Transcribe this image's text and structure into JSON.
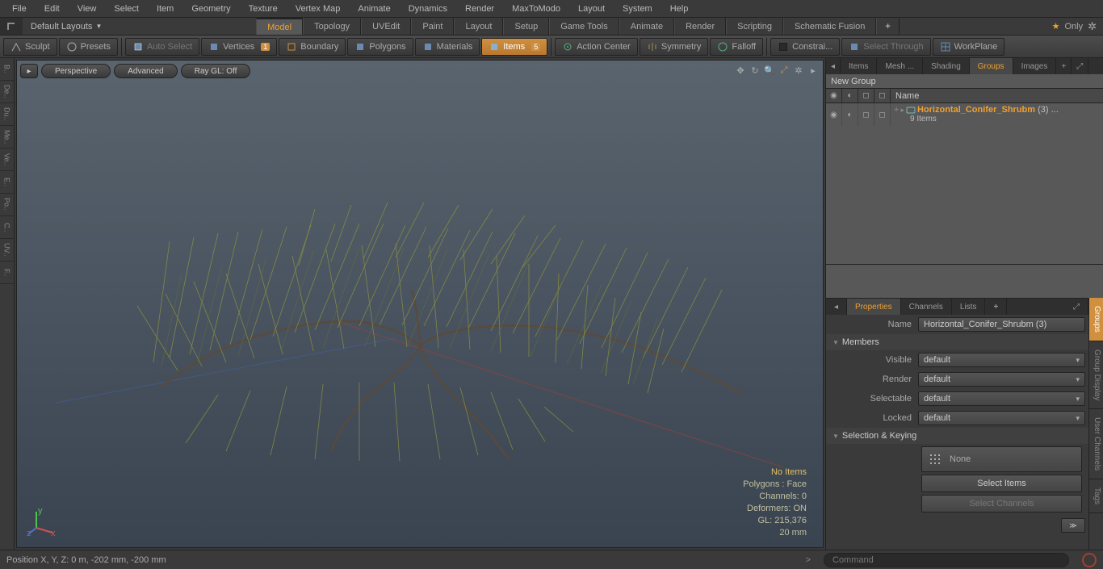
{
  "menu": [
    "File",
    "Edit",
    "View",
    "Select",
    "Item",
    "Geometry",
    "Texture",
    "Vertex Map",
    "Animate",
    "Dynamics",
    "Render",
    "MaxToModo",
    "Layout",
    "System",
    "Help"
  ],
  "layout": {
    "label": "Default Layouts",
    "tabs": [
      "Model",
      "Topology",
      "UVEdit",
      "Paint",
      "Layout",
      "Setup",
      "Game Tools",
      "Animate",
      "Render",
      "Scripting",
      "Schematic Fusion"
    ],
    "active": "Model",
    "only": "Only"
  },
  "toolbar": {
    "sculpt": "Sculpt",
    "presets": "Presets",
    "autoselect": "Auto Select",
    "vertices": "Vertices",
    "verticesBadge": "1",
    "boundary": "Boundary",
    "polygons": "Polygons",
    "materials": "Materials",
    "items": "Items",
    "itemsBadge": "5",
    "actioncenter": "Action Center",
    "symmetry": "Symmetry",
    "falloff": "Falloff",
    "constrai": "Constrai...",
    "selectthrough": "Select Through",
    "workplane": "WorkPlane"
  },
  "leftgutter": [
    "B..",
    "De..",
    "Du..",
    "Me..",
    "Ve..",
    "E..",
    "Po..",
    "C..",
    "UV..",
    "F.."
  ],
  "viewport": {
    "pills": {
      "perspective": "Perspective",
      "advanced": "Advanced",
      "raygl": "Ray GL: Off"
    },
    "overlay": {
      "noitems": "No Items",
      "polygons": "Polygons : Face",
      "channels": "Channels: 0",
      "deformers": "Deformers: ON",
      "gl": "GL: 215,376",
      "scale": "20 mm"
    }
  },
  "rightTabs": [
    "Items",
    "Mesh ...",
    "Shading",
    "Groups",
    "Images"
  ],
  "rightActive": "Groups",
  "newGroup": "New Group",
  "listHead": "Name",
  "group": {
    "name": "Horizontal_Conifer_Shrubm",
    "suffix": "(3) ...",
    "sub": "9 Items"
  },
  "propTabs": [
    "Properties",
    "Channels",
    "Lists"
  ],
  "propActive": "Properties",
  "props": {
    "nameLabel": "Name",
    "nameVal": "Horizontal_Conifer_Shrubm (3)",
    "membersSection": "Members",
    "visible": "Visible",
    "render": "Render",
    "selectable": "Selectable",
    "locked": "Locked",
    "defVal": "default",
    "selKeySection": "Selection & Keying",
    "noneLabel": "None",
    "selItems": "Select Items",
    "selChannels": "Select Channels"
  },
  "sideTabs": [
    "Groups",
    "Group Display",
    "User Channels",
    "Tags"
  ],
  "status": {
    "pos": "Position X, Y, Z:   0 m, -202 mm, -200 mm",
    "cmd": "Command"
  }
}
